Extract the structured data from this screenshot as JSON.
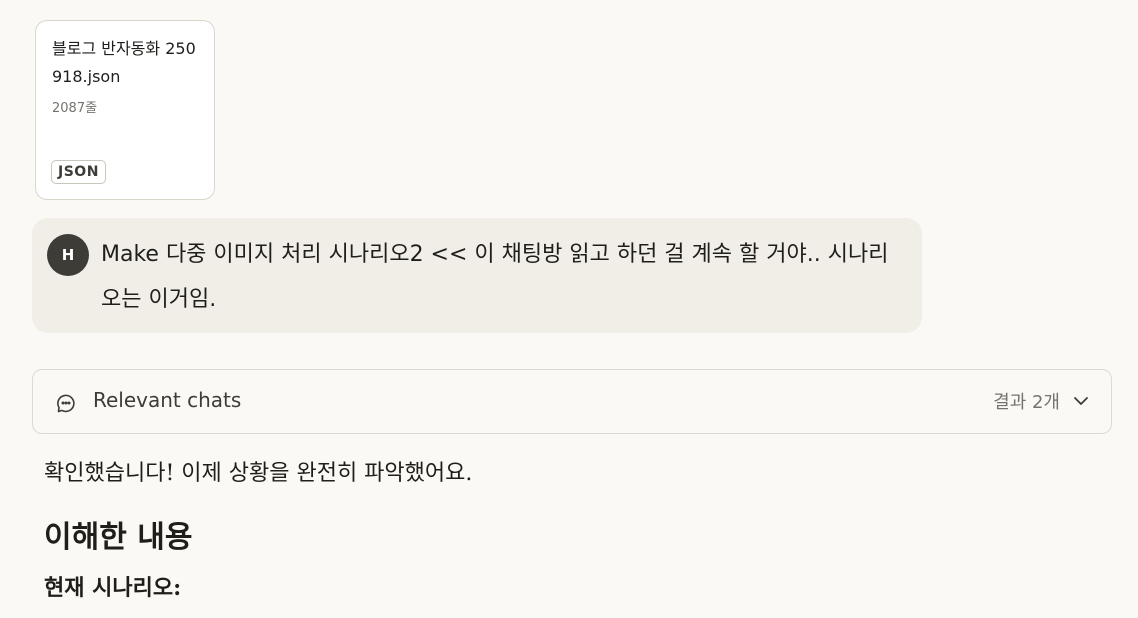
{
  "attachment": {
    "file_name": "블로그 반자동화 250918.json",
    "line_count": "2087줄",
    "type_badge": "JSON"
  },
  "user_message": {
    "avatar_initial": "H",
    "text": "Make 다중 이미지 처리 시나리오2 << 이 채팅방 읽고 하던 걸 계속 할 거야.. 시나리오는 이거임."
  },
  "relevant_chats": {
    "label": "Relevant chats",
    "result_count": "결과 2개",
    "icons": [
      "chat-bubbles-icon",
      "chevron-down-icon"
    ]
  },
  "assistant_response": {
    "intro": "확인했습니다! 이제 상황을 완전히 파악했어요.",
    "heading": "이해한 내용",
    "subheading": "현재 시나리오:"
  }
}
